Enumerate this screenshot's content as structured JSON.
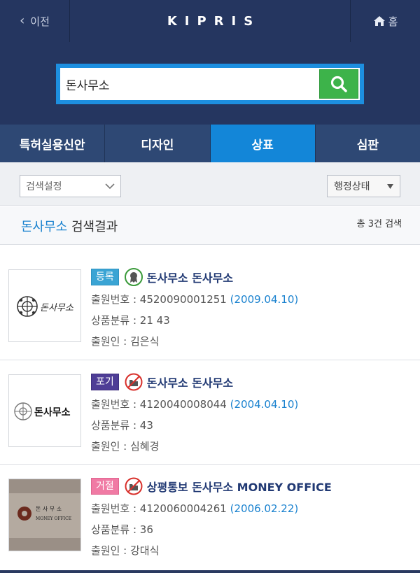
{
  "header": {
    "back_label": "이전",
    "logo": "KIPRIS",
    "home_label": "홈"
  },
  "search": {
    "value": "돈사무소"
  },
  "tabs": [
    {
      "label": "특허실용신안",
      "active": false
    },
    {
      "label": "디자인",
      "active": false
    },
    {
      "label": "상표",
      "active": true
    },
    {
      "label": "심판",
      "active": false
    }
  ],
  "filters": {
    "setting_label": "검색설정",
    "status_label": "행정상태"
  },
  "results_header": {
    "keyword": "돈사무소",
    "suffix": "검색결과",
    "count_text": "총 3건 검색"
  },
  "results": [
    {
      "badge": "등록",
      "name": "돈사무소 돈사무소",
      "app_no_label": "출원번호 : 4520090001251",
      "app_date": "(2009.04.10)",
      "class_text": "상품분류 : 21 43",
      "applicant_text": "출원인 : 김은식",
      "thumb_text": "돈사무소"
    },
    {
      "badge": "포기",
      "name": "돈사무소 돈사무소",
      "app_no_label": "출원번호 : 4120040008044",
      "app_date": "(2004.04.10)",
      "class_text": "상품분류 : 43",
      "applicant_text": "출원인 : 심혜경",
      "thumb_text": "돈사무소"
    },
    {
      "badge": "거절",
      "name": "상평통보 돈사무소 MONEY OFFICE",
      "app_no_label": "출원번호 : 4120060004261",
      "app_date": "(2006.02.22)",
      "class_text": "상품분류 : 36",
      "applicant_text": "출원인 : 강대식",
      "thumb_text": "돈 사 무 소",
      "thumb_text2": "MONEY OFFICE"
    }
  ],
  "colors": {
    "header_bg": "#253660",
    "tab_active": "#1386d8",
    "search_border": "#1d8fe0",
    "search_button": "#3db34a",
    "link_blue": "#1a82cf",
    "badge_registered": "#3aa4d4",
    "badge_abandoned": "#4e3d96",
    "badge_rejected": "#f07aa4"
  }
}
